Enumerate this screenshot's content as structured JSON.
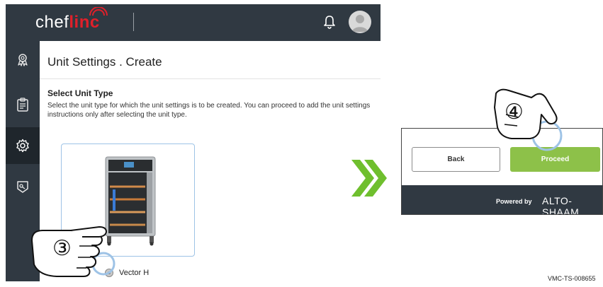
{
  "app": {
    "logo_left": "chef",
    "logo_right": "linc",
    "page_title": "Unit Settings . Create",
    "section_title": "Select Unit Type",
    "section_desc": "Select the unit type for which the unit settings is to be created. You can proceed to add the unit settings instructions only after selecting the unit type.",
    "sidebar": [
      {
        "icon": "award-icon"
      },
      {
        "icon": "clipboard-icon"
      },
      {
        "icon": "gear-icon",
        "active": true
      },
      {
        "icon": "tag-icon"
      }
    ],
    "unit_option": {
      "label": "Vector H",
      "selected": false
    }
  },
  "zoom_panel": {
    "back_label": "Back",
    "proceed_label": "Proceed",
    "powered_by": "Powered by",
    "brand": "ALTO-SHAAM"
  },
  "steps": {
    "step3": "③",
    "step4": "④"
  },
  "doc_id": "VMC-TS-008655",
  "colors": {
    "header_bg": "#303942",
    "accent_green": "#8dc149",
    "logo_red": "#e0202a",
    "card_border": "#9ec3e6"
  }
}
